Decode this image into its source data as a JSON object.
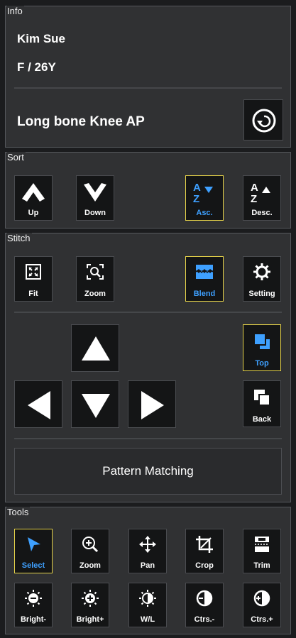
{
  "info": {
    "title": "Info",
    "patient_name": "Kim Sue",
    "patient_demo": "F / 26Y",
    "protocol": "Long bone Knee AP",
    "reset_icon": "rotate-ccw-icon"
  },
  "sort": {
    "title": "Sort",
    "up_label": "Up",
    "down_label": "Down",
    "asc_label": "Asc.",
    "desc_label": "Desc.",
    "selected": "Asc."
  },
  "stitch": {
    "title": "Stitch",
    "fit_label": "Fit",
    "zoom_label": "Zoom",
    "blend_label": "Blend",
    "setting_label": "Setting",
    "top_label": "Top",
    "back_label": "Back",
    "pattern_label": "Pattern Matching",
    "selected": [
      "Blend",
      "Top"
    ]
  },
  "tools": {
    "title": "Tools",
    "select_label": "Select",
    "zoom_label": "Zoom",
    "pan_label": "Pan",
    "crop_label": "Crop",
    "trim_label": "Trim",
    "bright_minus_label": "Bright-",
    "bright_plus_label": "Bright+",
    "wl_label": "W/L",
    "ctrs_minus_label": "Ctrs.-",
    "ctrs_plus_label": "Ctrs.+",
    "selected": "Select"
  },
  "colors": {
    "accent_blue": "#3ea0ff",
    "selected_border": "#e6d34a",
    "panel_bg": "#303133",
    "button_bg": "#141516"
  }
}
